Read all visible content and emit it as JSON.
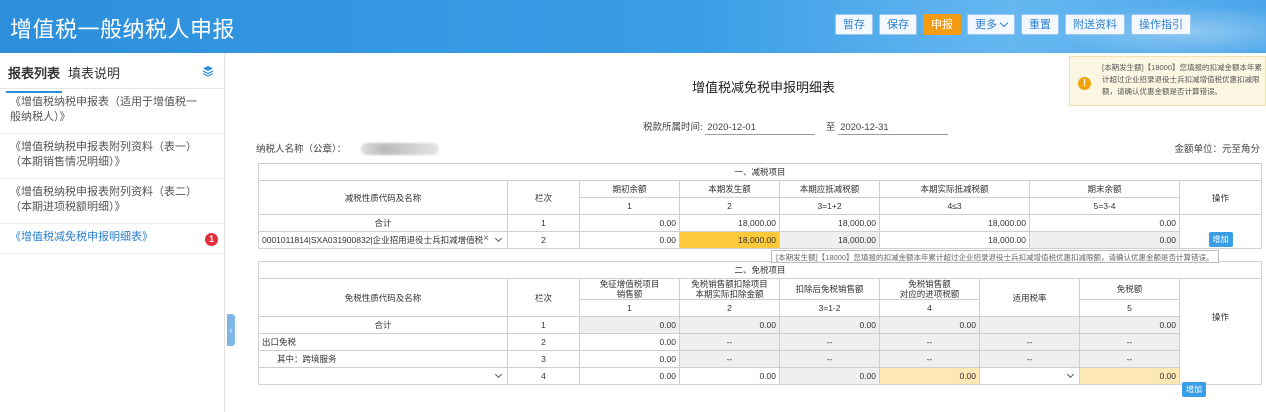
{
  "app": {
    "title": "增值税一般纳税人申报"
  },
  "toolbar": {
    "buttons": [
      {
        "label": "暂存"
      },
      {
        "label": "保存"
      },
      {
        "label": "申报"
      },
      {
        "label": "更多"
      },
      {
        "label": "重置"
      },
      {
        "label": "附送资料"
      },
      {
        "label": "操作指引"
      }
    ]
  },
  "sidebar": {
    "tabs": [
      "报表列表",
      "填表说明"
    ],
    "items": [
      {
        "label": "《增值税纳税申报表（适用于增值税一般纳税人）》"
      },
      {
        "label": "《增值税纳税申报表附列资料（表一）（本期销售情况明细）》"
      },
      {
        "label": "《增值税纳税申报表附列资料（表二）（本期进项税额明细）》"
      },
      {
        "label": "《增值税减免税申报明细表》",
        "badge": "1"
      }
    ]
  },
  "form": {
    "title": "增值税减免税申报明细表",
    "period_label": "税款所属时间:",
    "period_start": "2020-12-01",
    "period_to": "至",
    "period_end": "2020-12-31",
    "taxpayer_label": "纳税人名称（公章）：",
    "unit": "金额单位：元至角分"
  },
  "notice": {
    "text": "[本期发生额]【18000】您填报的扣减金额本年累计超过企业招录退役士兵扣减增值税优惠扣减限额，请确认优惠金额是否计算错误。"
  },
  "tooltip": {
    "text": "[本期发生额]【18000】您填报的扣减金额本年累计超过企业招录退役士兵扣减增值税优惠扣减限额，请确认优惠金额是否计算错误。"
  },
  "section1": {
    "title": "一、减税项目",
    "headers": {
      "name": "减税性质代码及名称",
      "row_no": "栏次",
      "opening": "期初余额",
      "current": "本期发生额",
      "deductible": "本期应抵减税额",
      "actual": "本期实际抵减税额",
      "closing": "期末余额",
      "op": "操作"
    },
    "col_nums": {
      "opening": "1",
      "current": "2",
      "deductible": "3=1+2",
      "actual": "4≤3",
      "closing": "5=3-4"
    },
    "total": {
      "name": "合计",
      "row_no": "1",
      "opening": "0.00",
      "current": "18,000.00",
      "deductible": "18,000.00",
      "actual": "18,000.00",
      "closing": "0.00"
    },
    "row2": {
      "name": "0001011814|SXA031900832|企业招用退役士兵扣减增值税",
      "clear": "×",
      "row_no": "2",
      "opening": "0.00",
      "current": "18,000.00",
      "deductible": "18,000.00",
      "actual": "18,000.00",
      "closing": "0.00",
      "add": "增加"
    }
  },
  "section2": {
    "title": "二、免税项目",
    "headers": {
      "name": "免税性质代码及名称",
      "row_no": "栏次",
      "sales": "免征增值税项目\n销售额",
      "deduct": "免税销售额扣除项目\n本期实际扣除金额",
      "after": "扣除后免税销售额",
      "input_tax": "免税销售额\n对应的进项税额",
      "rate": "适用税率",
      "tax": "免税额",
      "op": "操作"
    },
    "col_nums": {
      "sales": "1",
      "deduct": "2",
      "after": "3=1-2",
      "input_tax": "4",
      "tax": "5"
    },
    "rows": [
      {
        "name": "合计",
        "row_no": "1",
        "sales": "0.00",
        "deduct": "0.00",
        "after": "0.00",
        "input_tax": "0.00",
        "rate": "",
        "tax": "0.00"
      },
      {
        "name": "出口免税",
        "row_no": "2",
        "sales": "0.00",
        "deduct": "--",
        "after": "--",
        "input_tax": "--",
        "rate": "--",
        "tax": "--"
      },
      {
        "name": "其中：跨境服务",
        "row_no": "3",
        "sales": "0.00",
        "deduct": "--",
        "after": "--",
        "input_tax": "--",
        "rate": "--",
        "tax": "--"
      },
      {
        "name": "",
        "row_no": "4",
        "sales": "0.00",
        "deduct": "0.00",
        "after": "0.00",
        "input_tax": "0.00",
        "rate": "",
        "tax": "0.00",
        "add": "增加"
      }
    ]
  }
}
